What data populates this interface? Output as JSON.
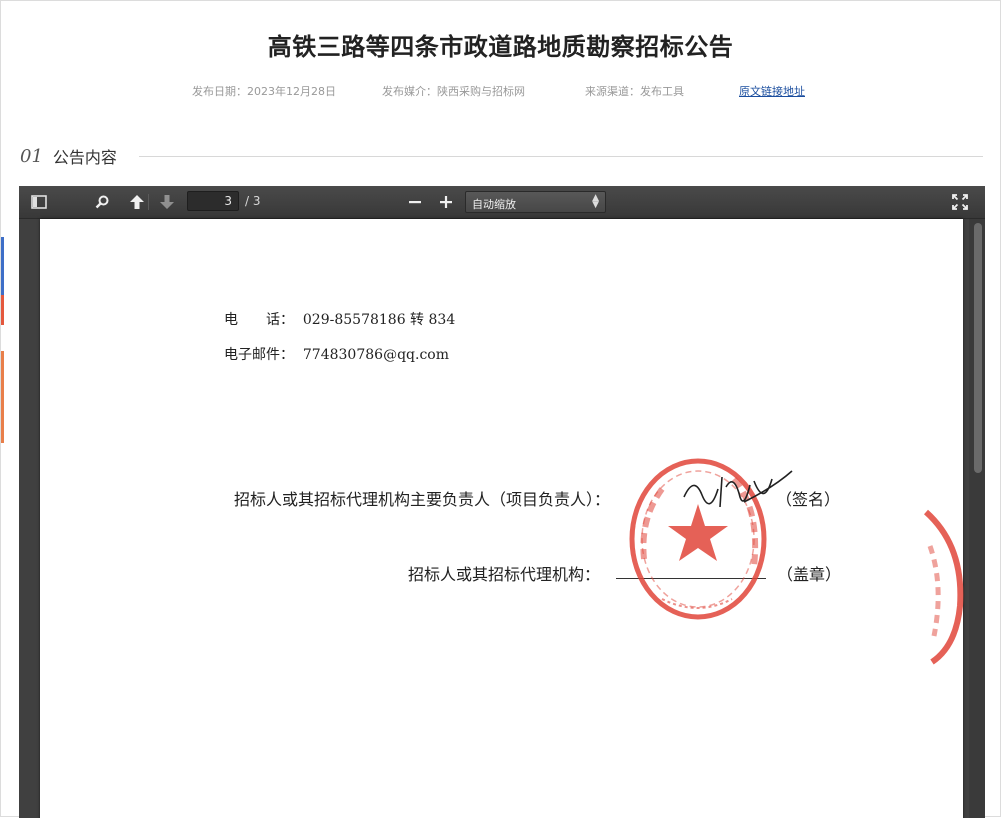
{
  "page": {
    "title": "高铁三路等四条市政道路地质勘察招标公告",
    "meta": {
      "date": "发布日期：2023年12月28日",
      "media": "发布媒介：陕西采购与招标网",
      "source": "来源渠道：发布工具",
      "link_label": "原文链接地址"
    },
    "section": {
      "num": "01",
      "label": "公告内容"
    }
  },
  "viewer": {
    "page_current": "3",
    "page_total": "/ 3",
    "zoom": "自动缩放",
    "icons": [
      "sidebar-toggle-icon",
      "search-icon",
      "previous-page-icon",
      "next-page-icon",
      "zoom-out-icon",
      "zoom-in-icon",
      "fullscreen-icon"
    ]
  },
  "document": {
    "phone": "电　　话：  029-85578186 转 834",
    "email": "电子邮件：  774830786@qq.com",
    "sign_line": "招标人或其招标代理机构主要负责人（项目负责人）：",
    "sign_tail": "（签名）",
    "stamp_line": "招标人或其招标代理机构：",
    "stamp_tail": "（盖章）",
    "seal_color": "#e0453a"
  }
}
